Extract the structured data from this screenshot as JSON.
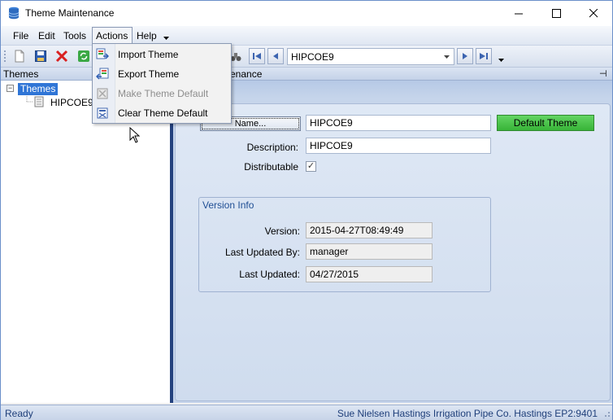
{
  "window": {
    "title": "Theme Maintenance"
  },
  "menubar": {
    "items": [
      "File",
      "Edit",
      "Tools",
      "Actions",
      "Help"
    ]
  },
  "toolbar": {
    "theme_select_value": "HIPCOE9"
  },
  "left_panel": {
    "header": "Themes",
    "tree": {
      "root": "Themes",
      "children": [
        "HIPCOE9"
      ]
    }
  },
  "right_panel": {
    "header": "enance"
  },
  "form": {
    "name_button": "Name...",
    "name_value": "HIPCOE9",
    "default_theme_button": "Default Theme",
    "description_label": "Description:",
    "description_value": "HIPCOE9",
    "distributable_label": "Distributable",
    "distributable_checked": true,
    "version_group": {
      "title": "Version Info",
      "version_label": "Version:",
      "version_value": "2015-04-27T08:49:49",
      "last_updated_by_label": "Last Updated By:",
      "last_updated_by_value": "manager",
      "last_updated_label": "Last Updated:",
      "last_updated_value": "04/27/2015"
    }
  },
  "actions_menu": {
    "items": [
      {
        "label": "Import Theme",
        "enabled": true,
        "icon": "import-theme-icon"
      },
      {
        "label": "Export Theme",
        "enabled": true,
        "icon": "export-theme-icon"
      },
      {
        "label": "Make Theme Default",
        "enabled": false,
        "icon": "make-default-icon"
      },
      {
        "label": "Clear Theme Default",
        "enabled": true,
        "icon": "clear-default-icon"
      }
    ]
  },
  "statusbar": {
    "status": "Ready",
    "info": "Sue Nielsen  Hastings Irrigation Pipe Co.  Hastings  EP2:9401"
  },
  "colors": {
    "selection": "#2f75d6",
    "splitter": "#24427e",
    "default_button": "#4cc44c",
    "panel_bg": "#c6d5eb"
  }
}
